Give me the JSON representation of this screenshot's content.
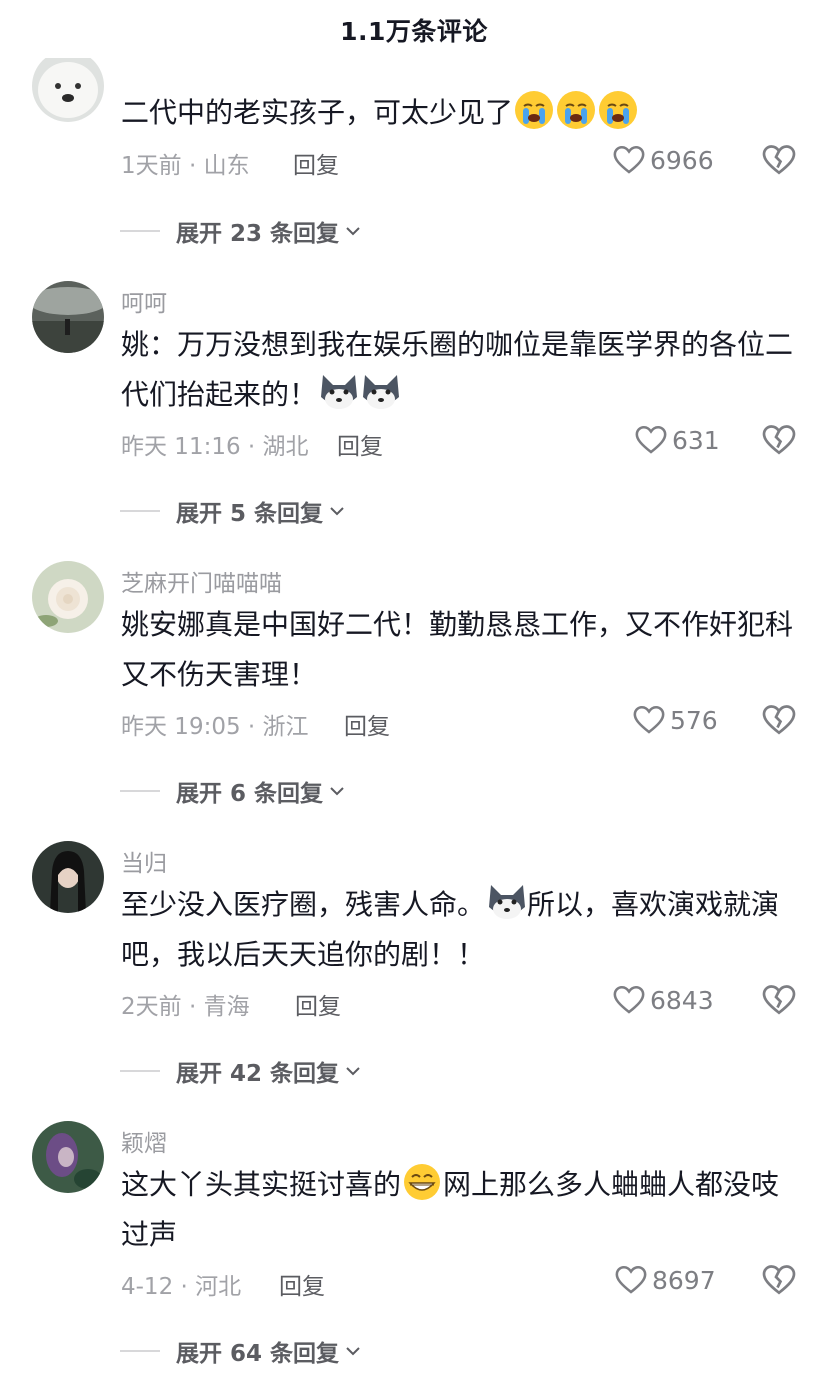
{
  "header": {
    "title": "1.1万条评论"
  },
  "comments": [
    {
      "username": "",
      "text_before": "二代中的老实孩子，可太少见了",
      "text_after": "",
      "emoji": [
        "loudly-crying-face-emoji",
        "loudly-crying-face-emoji",
        "loudly-crying-face-emoji"
      ],
      "time_location": "1天前 · 山东",
      "reply_label": "回复",
      "likes": "6966",
      "expand_label": "展开 23 条回复"
    },
    {
      "username": "呵呵",
      "text_before": "姚：万万没想到我在娱乐圈的咖位是靠医学界的各位二代们抬起来的！",
      "text_after": "",
      "emoji": [
        "husky-dog-emoji",
        "husky-dog-emoji"
      ],
      "time_location": "昨天 11:16 · 湖北",
      "reply_label": "回复",
      "likes": "631",
      "expand_label": "展开 5 条回复"
    },
    {
      "username": "芝麻开门喵喵喵",
      "text_before": "姚安娜真是中国好二代！勤勤恳恳工作，又不作奸犯科又不伤天害理！",
      "text_after": "",
      "emoji": [],
      "time_location": "昨天 19:05 · 浙江",
      "reply_label": "回复",
      "likes": "576",
      "expand_label": "展开 6 条回复"
    },
    {
      "username": "当归",
      "text_before": "至少没入医疗圈，残害人命。",
      "text_after": "所以，喜欢演戏就演吧，我以后天天追你的剧！！",
      "emoji": [
        "husky-dog-emoji"
      ],
      "time_location": "2天前 · 青海",
      "reply_label": "回复",
      "likes": "6843",
      "expand_label": "展开 42 条回复"
    },
    {
      "username": "颖熠",
      "text_before": "这大丫头其实挺讨喜的",
      "text_after": "网上那么多人蛐蛐人都没吱过声",
      "emoji": [
        "grinning-face-emoji"
      ],
      "time_location": "4-12 · 河北",
      "reply_label": "回复",
      "likes": "8697",
      "expand_label": "展开 64 条回复"
    }
  ],
  "icons": {
    "like": "heart-outline-icon",
    "dislike": "broken-heart-icon",
    "expand": "chevron-down-icon"
  },
  "colors": {
    "text_primary": "#161823",
    "text_secondary": "#a1a2a7",
    "reply": "#5b5c61"
  }
}
